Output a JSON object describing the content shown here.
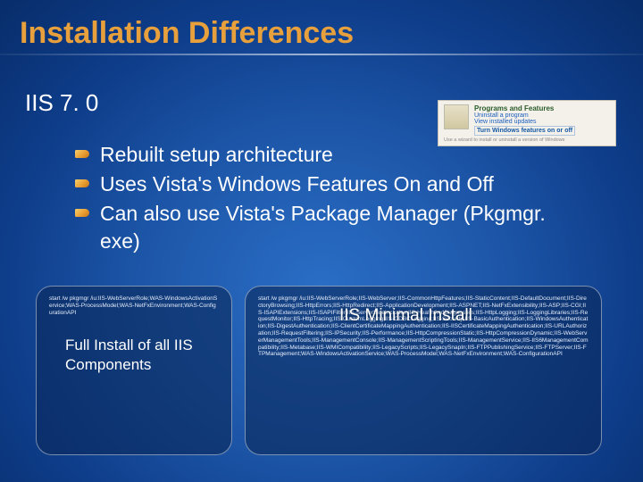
{
  "title": "Installation Differences",
  "subtitle": "IIS 7. 0",
  "winFeatures": {
    "header": "Programs and Features",
    "link1": "Uninstall a program",
    "link2": "View installed updates",
    "link3": "Turn Windows features on or off",
    "hint": "Use a wizard to install or uninstall a version of Windows"
  },
  "bullets": [
    "Rebuilt setup architecture",
    "Uses Vista's Windows Features On and Off",
    "Can also use Vista's Package Manager (Pkgmgr. exe)"
  ],
  "leftBox": {
    "cmd": "start /w pkgmgr /iu:IIS-WebServerRole;WAS-WindowsActivationService;WAS-ProcessModel;WAS-NetFxEnvironment;WAS-ConfigurationAPI",
    "captionLine1": "Full Install of all IIS",
    "captionLine2": "Components"
  },
  "rightBox": {
    "caption": "IIS Minimal Install",
    "cmd": "start /w pkgmgr /iu:IIS-WebServerRole;IIS-WebServer;IIS-CommonHttpFeatures;IIS-StaticContent;IIS-DefaultDocument;IIS-DirectoryBrowsing;IIS-HttpErrors;IIS-HttpRedirect;IIS-ApplicationDevelopment;IIS-ASPNET;IIS-NetFxExtensibility;IIS-ASP;IIS-CGI;IIS-ISAPIExtensions;IIS-ISAPIFilter;IIS-ServerSideIncludes;IIS-HealthAndDiagnostics;IIS-HttpLogging;IIS-LoggingLibraries;IIS-RequestMonitor;IIS-HttpTracing;IIS-CustomLogging;IIS-ODBCLogging;IIS-Security;IIS-BasicAuthentication;IIS-WindowsAuthentication;IIS-DigestAuthentication;IIS-ClientCertificateMappingAuthentication;IIS-IISCertificateMappingAuthentication;IIS-URLAuthorization;IIS-RequestFiltering;IIS-IPSecurity;IIS-Performance;IIS-HttpCompressionStatic;IIS-HttpCompressionDynamic;IIS-WebServerManagementTools;IIS-ManagementConsole;IIS-ManagementScriptingTools;IIS-ManagementService;IIS-IIS6ManagementCompatibility;IIS-Metabase;IIS-WMICompatibility;IIS-LegacyScripts;IIS-LegacySnapIn;IIS-FTPPublishingService;IIS-FTPServer;IIS-FTPManagement;WAS-WindowsActivationService;WAS-ProcessModel;WAS-NetFxEnvironment;WAS-ConfigurationAPI"
  }
}
